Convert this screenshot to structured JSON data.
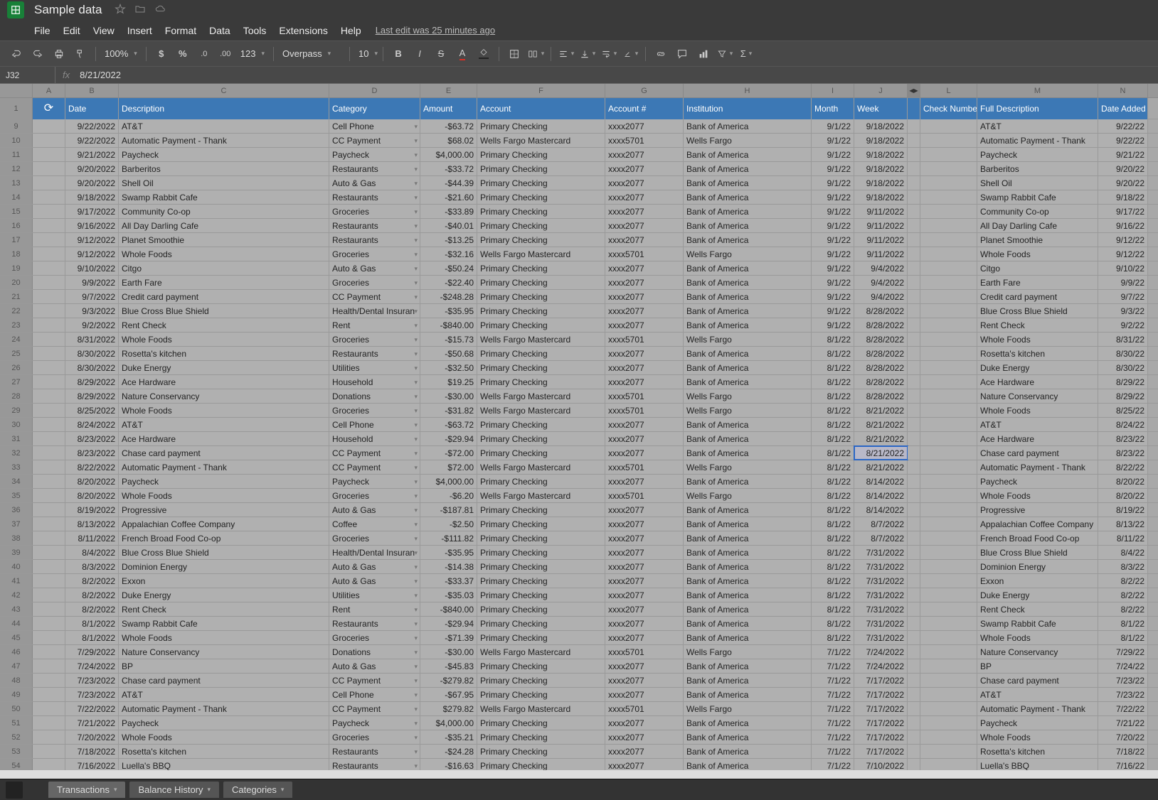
{
  "doc": {
    "name": "Sample data",
    "last_edit": "Last edit was 25 minutes ago"
  },
  "menu": [
    "File",
    "Edit",
    "View",
    "Insert",
    "Format",
    "Data",
    "Tools",
    "Extensions",
    "Help"
  ],
  "toolbar": {
    "zoom": "100%",
    "font": "Overpass",
    "size": "10"
  },
  "namebox": "J32",
  "formula": "8/21/2022",
  "columns": [
    "A",
    "B",
    "C",
    "D",
    "E",
    "F",
    "G",
    "H",
    "I",
    "J",
    "L",
    "M",
    "N"
  ],
  "headers": {
    "A": "",
    "B": "Date",
    "C": "Description",
    "D": "Category",
    "E": "Amount",
    "F": "Account",
    "G": "Account #",
    "H": "Institution",
    "I": "Month",
    "J": "Week",
    "L": "Check Number",
    "M": "Full Description",
    "N": "Date Added"
  },
  "rows": [
    {
      "n": 9,
      "B": "9/22/2022",
      "C": "AT&T",
      "D": "Cell Phone",
      "E": "-$63.72",
      "F": "Primary Checking",
      "G": "xxxx2077",
      "H": "Bank of America",
      "I": "9/1/22",
      "J": "9/18/2022",
      "M": "AT&T",
      "N": "9/22/22"
    },
    {
      "n": 10,
      "B": "9/22/2022",
      "C": "Automatic Payment - Thank",
      "D": "CC Payment",
      "E": "$68.02",
      "F": "Wells Fargo Mastercard",
      "G": "xxxx5701",
      "H": "Wells Fargo",
      "I": "9/1/22",
      "J": "9/18/2022",
      "M": "Automatic Payment - Thank",
      "N": "9/22/22"
    },
    {
      "n": 11,
      "B": "9/21/2022",
      "C": "Paycheck",
      "D": "Paycheck",
      "E": "$4,000.00",
      "F": "Primary Checking",
      "G": "xxxx2077",
      "H": "Bank of America",
      "I": "9/1/22",
      "J": "9/18/2022",
      "M": "Paycheck",
      "N": "9/21/22"
    },
    {
      "n": 12,
      "B": "9/20/2022",
      "C": "Barberitos",
      "D": "Restaurants",
      "E": "-$33.72",
      "F": "Primary Checking",
      "G": "xxxx2077",
      "H": "Bank of America",
      "I": "9/1/22",
      "J": "9/18/2022",
      "M": "Barberitos",
      "N": "9/20/22"
    },
    {
      "n": 13,
      "B": "9/20/2022",
      "C": "Shell Oil",
      "D": "Auto & Gas",
      "E": "-$44.39",
      "F": "Primary Checking",
      "G": "xxxx2077",
      "H": "Bank of America",
      "I": "9/1/22",
      "J": "9/18/2022",
      "M": "Shell Oil",
      "N": "9/20/22"
    },
    {
      "n": 14,
      "B": "9/18/2022",
      "C": "Swamp Rabbit Cafe",
      "D": "Restaurants",
      "E": "-$21.60",
      "F": "Primary Checking",
      "G": "xxxx2077",
      "H": "Bank of America",
      "I": "9/1/22",
      "J": "9/18/2022",
      "M": "Swamp Rabbit Cafe",
      "N": "9/18/22"
    },
    {
      "n": 15,
      "B": "9/17/2022",
      "C": "Community Co-op",
      "D": "Groceries",
      "E": "-$33.89",
      "F": "Primary Checking",
      "G": "xxxx2077",
      "H": "Bank of America",
      "I": "9/1/22",
      "J": "9/11/2022",
      "M": "Community Co-op",
      "N": "9/17/22"
    },
    {
      "n": 16,
      "B": "9/16/2022",
      "C": "All Day Darling Cafe",
      "D": "Restaurants",
      "E": "-$40.01",
      "F": "Primary Checking",
      "G": "xxxx2077",
      "H": "Bank of America",
      "I": "9/1/22",
      "J": "9/11/2022",
      "M": "All Day Darling Cafe",
      "N": "9/16/22"
    },
    {
      "n": 17,
      "B": "9/12/2022",
      "C": "Planet Smoothie",
      "D": "Restaurants",
      "E": "-$13.25",
      "F": "Primary Checking",
      "G": "xxxx2077",
      "H": "Bank of America",
      "I": "9/1/22",
      "J": "9/11/2022",
      "M": "Planet Smoothie",
      "N": "9/12/22"
    },
    {
      "n": 18,
      "B": "9/12/2022",
      "C": "Whole Foods",
      "D": "Groceries",
      "E": "-$32.16",
      "F": "Wells Fargo Mastercard",
      "G": "xxxx5701",
      "H": "Wells Fargo",
      "I": "9/1/22",
      "J": "9/11/2022",
      "M": "Whole Foods",
      "N": "9/12/22"
    },
    {
      "n": 19,
      "B": "9/10/2022",
      "C": "Citgo",
      "D": "Auto & Gas",
      "E": "-$50.24",
      "F": "Primary Checking",
      "G": "xxxx2077",
      "H": "Bank of America",
      "I": "9/1/22",
      "J": "9/4/2022",
      "M": "Citgo",
      "N": "9/10/22"
    },
    {
      "n": 20,
      "B": "9/9/2022",
      "C": "Earth Fare",
      "D": "Groceries",
      "E": "-$22.40",
      "F": "Primary Checking",
      "G": "xxxx2077",
      "H": "Bank of America",
      "I": "9/1/22",
      "J": "9/4/2022",
      "M": "Earth Fare",
      "N": "9/9/22"
    },
    {
      "n": 21,
      "B": "9/7/2022",
      "C": "Credit card payment",
      "D": "CC Payment",
      "E": "-$248.28",
      "F": "Primary Checking",
      "G": "xxxx2077",
      "H": "Bank of America",
      "I": "9/1/22",
      "J": "9/4/2022",
      "M": "Credit card payment",
      "N": "9/7/22"
    },
    {
      "n": 22,
      "B": "9/3/2022",
      "C": "Blue Cross Blue Shield",
      "D": "Health/Dental Insuran",
      "E": "-$35.95",
      "F": "Primary Checking",
      "G": "xxxx2077",
      "H": "Bank of America",
      "I": "9/1/22",
      "J": "8/28/2022",
      "M": "Blue Cross Blue Shield",
      "N": "9/3/22"
    },
    {
      "n": 23,
      "B": "9/2/2022",
      "C": "Rent Check",
      "D": "Rent",
      "E": "-$840.00",
      "F": "Primary Checking",
      "G": "xxxx2077",
      "H": "Bank of America",
      "I": "9/1/22",
      "J": "8/28/2022",
      "M": "Rent Check",
      "N": "9/2/22"
    },
    {
      "n": 24,
      "B": "8/31/2022",
      "C": "Whole Foods",
      "D": "Groceries",
      "E": "-$15.73",
      "F": "Wells Fargo Mastercard",
      "G": "xxxx5701",
      "H": "Wells Fargo",
      "I": "8/1/22",
      "J": "8/28/2022",
      "M": "Whole Foods",
      "N": "8/31/22"
    },
    {
      "n": 25,
      "B": "8/30/2022",
      "C": "Rosetta's kitchen",
      "D": "Restaurants",
      "E": "-$50.68",
      "F": "Primary Checking",
      "G": "xxxx2077",
      "H": "Bank of America",
      "I": "8/1/22",
      "J": "8/28/2022",
      "M": "Rosetta's kitchen",
      "N": "8/30/22"
    },
    {
      "n": 26,
      "B": "8/30/2022",
      "C": "Duke Energy",
      "D": "Utilities",
      "E": "-$32.50",
      "F": "Primary Checking",
      "G": "xxxx2077",
      "H": "Bank of America",
      "I": "8/1/22",
      "J": "8/28/2022",
      "M": "Duke Energy",
      "N": "8/30/22"
    },
    {
      "n": 27,
      "B": "8/29/2022",
      "C": "Ace Hardware",
      "D": "Household",
      "E": "$19.25",
      "F": "Primary Checking",
      "G": "xxxx2077",
      "H": "Bank of America",
      "I": "8/1/22",
      "J": "8/28/2022",
      "M": "Ace Hardware",
      "N": "8/29/22"
    },
    {
      "n": 28,
      "B": "8/29/2022",
      "C": "Nature Conservancy",
      "D": "Donations",
      "E": "-$30.00",
      "F": "Wells Fargo Mastercard",
      "G": "xxxx5701",
      "H": "Wells Fargo",
      "I": "8/1/22",
      "J": "8/28/2022",
      "M": "Nature Conservancy",
      "N": "8/29/22"
    },
    {
      "n": 29,
      "B": "8/25/2022",
      "C": "Whole Foods",
      "D": "Groceries",
      "E": "-$31.82",
      "F": "Wells Fargo Mastercard",
      "G": "xxxx5701",
      "H": "Wells Fargo",
      "I": "8/1/22",
      "J": "8/21/2022",
      "M": "Whole Foods",
      "N": "8/25/22"
    },
    {
      "n": 30,
      "B": "8/24/2022",
      "C": "AT&T",
      "D": "Cell Phone",
      "E": "-$63.72",
      "F": "Primary Checking",
      "G": "xxxx2077",
      "H": "Bank of America",
      "I": "8/1/22",
      "J": "8/21/2022",
      "M": "AT&T",
      "N": "8/24/22"
    },
    {
      "n": 31,
      "B": "8/23/2022",
      "C": "Ace Hardware",
      "D": "Household",
      "E": "-$29.94",
      "F": "Primary Checking",
      "G": "xxxx2077",
      "H": "Bank of America",
      "I": "8/1/22",
      "J": "8/21/2022",
      "M": "Ace Hardware",
      "N": "8/23/22"
    },
    {
      "n": 32,
      "B": "8/23/2022",
      "C": "Chase card payment",
      "D": "CC Payment",
      "E": "-$72.00",
      "F": "Primary Checking",
      "G": "xxxx2077",
      "H": "Bank of America",
      "I": "8/1/22",
      "J": "8/21/2022",
      "M": "Chase card payment",
      "N": "8/23/22",
      "selJ": true
    },
    {
      "n": 33,
      "B": "8/22/2022",
      "C": "Automatic Payment - Thank",
      "D": "CC Payment",
      "E": "$72.00",
      "F": "Wells Fargo Mastercard",
      "G": "xxxx5701",
      "H": "Wells Fargo",
      "I": "8/1/22",
      "J": "8/21/2022",
      "M": "Automatic Payment - Thank",
      "N": "8/22/22"
    },
    {
      "n": 34,
      "B": "8/20/2022",
      "C": "Paycheck",
      "D": "Paycheck",
      "E": "$4,000.00",
      "F": "Primary Checking",
      "G": "xxxx2077",
      "H": "Bank of America",
      "I": "8/1/22",
      "J": "8/14/2022",
      "M": "Paycheck",
      "N": "8/20/22"
    },
    {
      "n": 35,
      "B": "8/20/2022",
      "C": "Whole Foods",
      "D": "Groceries",
      "E": "-$6.20",
      "F": "Wells Fargo Mastercard",
      "G": "xxxx5701",
      "H": "Wells Fargo",
      "I": "8/1/22",
      "J": "8/14/2022",
      "M": "Whole Foods",
      "N": "8/20/22"
    },
    {
      "n": 36,
      "B": "8/19/2022",
      "C": "Progressive",
      "D": "Auto & Gas",
      "E": "-$187.81",
      "F": "Primary Checking",
      "G": "xxxx2077",
      "H": "Bank of America",
      "I": "8/1/22",
      "J": "8/14/2022",
      "M": "Progressive",
      "N": "8/19/22"
    },
    {
      "n": 37,
      "B": "8/13/2022",
      "C": "Appalachian Coffee Company",
      "D": "Coffee",
      "E": "-$2.50",
      "F": "Primary Checking",
      "G": "xxxx2077",
      "H": "Bank of America",
      "I": "8/1/22",
      "J": "8/7/2022",
      "M": "Appalachian Coffee Company",
      "N": "8/13/22"
    },
    {
      "n": 38,
      "B": "8/11/2022",
      "C": "French Broad Food Co-op",
      "D": "Groceries",
      "E": "-$111.82",
      "F": "Primary Checking",
      "G": "xxxx2077",
      "H": "Bank of America",
      "I": "8/1/22",
      "J": "8/7/2022",
      "M": "French Broad Food Co-op",
      "N": "8/11/22"
    },
    {
      "n": 39,
      "B": "8/4/2022",
      "C": "Blue Cross Blue Shield",
      "D": "Health/Dental Insuran",
      "E": "-$35.95",
      "F": "Primary Checking",
      "G": "xxxx2077",
      "H": "Bank of America",
      "I": "8/1/22",
      "J": "7/31/2022",
      "M": "Blue Cross Blue Shield",
      "N": "8/4/22"
    },
    {
      "n": 40,
      "B": "8/3/2022",
      "C": "Dominion Energy",
      "D": "Auto & Gas",
      "E": "-$14.38",
      "F": "Primary Checking",
      "G": "xxxx2077",
      "H": "Bank of America",
      "I": "8/1/22",
      "J": "7/31/2022",
      "M": "Dominion Energy",
      "N": "8/3/22"
    },
    {
      "n": 41,
      "B": "8/2/2022",
      "C": "Exxon",
      "D": "Auto & Gas",
      "E": "-$33.37",
      "F": "Primary Checking",
      "G": "xxxx2077",
      "H": "Bank of America",
      "I": "8/1/22",
      "J": "7/31/2022",
      "M": "Exxon",
      "N": "8/2/22"
    },
    {
      "n": 42,
      "B": "8/2/2022",
      "C": "Duke Energy",
      "D": "Utilities",
      "E": "-$35.03",
      "F": "Primary Checking",
      "G": "xxxx2077",
      "H": "Bank of America",
      "I": "8/1/22",
      "J": "7/31/2022",
      "M": "Duke Energy",
      "N": "8/2/22"
    },
    {
      "n": 43,
      "B": "8/2/2022",
      "C": "Rent Check",
      "D": "Rent",
      "E": "-$840.00",
      "F": "Primary Checking",
      "G": "xxxx2077",
      "H": "Bank of America",
      "I": "8/1/22",
      "J": "7/31/2022",
      "M": "Rent Check",
      "N": "8/2/22"
    },
    {
      "n": 44,
      "B": "8/1/2022",
      "C": "Swamp Rabbit Cafe",
      "D": "Restaurants",
      "E": "-$29.94",
      "F": "Primary Checking",
      "G": "xxxx2077",
      "H": "Bank of America",
      "I": "8/1/22",
      "J": "7/31/2022",
      "M": "Swamp Rabbit Cafe",
      "N": "8/1/22"
    },
    {
      "n": 45,
      "B": "8/1/2022",
      "C": "Whole Foods",
      "D": "Groceries",
      "E": "-$71.39",
      "F": "Primary Checking",
      "G": "xxxx2077",
      "H": "Bank of America",
      "I": "8/1/22",
      "J": "7/31/2022",
      "M": "Whole Foods",
      "N": "8/1/22"
    },
    {
      "n": 46,
      "B": "7/29/2022",
      "C": "Nature Conservancy",
      "D": "Donations",
      "E": "-$30.00",
      "F": "Wells Fargo Mastercard",
      "G": "xxxx5701",
      "H": "Wells Fargo",
      "I": "7/1/22",
      "J": "7/24/2022",
      "M": "Nature Conservancy",
      "N": "7/29/22"
    },
    {
      "n": 47,
      "B": "7/24/2022",
      "C": "BP",
      "D": "Auto & Gas",
      "E": "-$45.83",
      "F": "Primary Checking",
      "G": "xxxx2077",
      "H": "Bank of America",
      "I": "7/1/22",
      "J": "7/24/2022",
      "M": "BP",
      "N": "7/24/22"
    },
    {
      "n": 48,
      "B": "7/23/2022",
      "C": "Chase card payment",
      "D": "CC Payment",
      "E": "-$279.82",
      "F": "Primary Checking",
      "G": "xxxx2077",
      "H": "Bank of America",
      "I": "7/1/22",
      "J": "7/17/2022",
      "M": "Chase card payment",
      "N": "7/23/22"
    },
    {
      "n": 49,
      "B": "7/23/2022",
      "C": "AT&T",
      "D": "Cell Phone",
      "E": "-$67.95",
      "F": "Primary Checking",
      "G": "xxxx2077",
      "H": "Bank of America",
      "I": "7/1/22",
      "J": "7/17/2022",
      "M": "AT&T",
      "N": "7/23/22"
    },
    {
      "n": 50,
      "B": "7/22/2022",
      "C": "Automatic Payment - Thank",
      "D": "CC Payment",
      "E": "$279.82",
      "F": "Wells Fargo Mastercard",
      "G": "xxxx5701",
      "H": "Wells Fargo",
      "I": "7/1/22",
      "J": "7/17/2022",
      "M": "Automatic Payment - Thank",
      "N": "7/22/22"
    },
    {
      "n": 51,
      "B": "7/21/2022",
      "C": "Paycheck",
      "D": "Paycheck",
      "E": "$4,000.00",
      "F": "Primary Checking",
      "G": "xxxx2077",
      "H": "Bank of America",
      "I": "7/1/22",
      "J": "7/17/2022",
      "M": "Paycheck",
      "N": "7/21/22"
    },
    {
      "n": 52,
      "B": "7/20/2022",
      "C": "Whole Foods",
      "D": "Groceries",
      "E": "-$35.21",
      "F": "Primary Checking",
      "G": "xxxx2077",
      "H": "Bank of America",
      "I": "7/1/22",
      "J": "7/17/2022",
      "M": "Whole Foods",
      "N": "7/20/22"
    },
    {
      "n": 53,
      "B": "7/18/2022",
      "C": "Rosetta's kitchen",
      "D": "Restaurants",
      "E": "-$24.28",
      "F": "Primary Checking",
      "G": "xxxx2077",
      "H": "Bank of America",
      "I": "7/1/22",
      "J": "7/17/2022",
      "M": "Rosetta's kitchen",
      "N": "7/18/22"
    },
    {
      "n": 54,
      "B": "7/16/2022",
      "C": "Luella's BBQ",
      "D": "Restaurants",
      "E": "-$16.63",
      "F": "Primary Checking",
      "G": "xxxx2077",
      "H": "Bank of America",
      "I": "7/1/22",
      "J": "7/10/2022",
      "M": "Luella's BBQ",
      "N": "7/16/22"
    }
  ],
  "tabs": [
    "Transactions",
    "Balance History",
    "Categories"
  ]
}
